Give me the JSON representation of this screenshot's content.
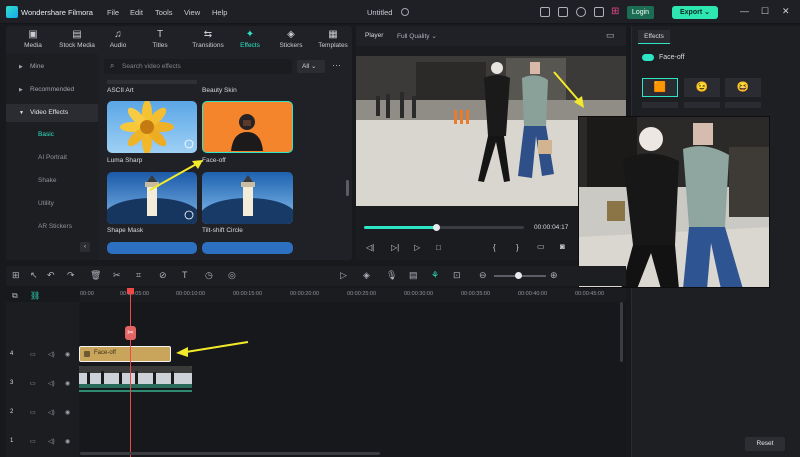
{
  "app": {
    "name": "Wondershare Filmora",
    "menu": [
      "File",
      "Edit",
      "Tools",
      "View",
      "Help"
    ],
    "project_title": "Untitled",
    "login_label": "Login",
    "export_label": "Export"
  },
  "library": {
    "tabs": [
      "Media",
      "Stock Media",
      "Audio",
      "Titles",
      "Transitions",
      "Effects",
      "Stickers",
      "Templates"
    ],
    "active_tab": "Effects",
    "sidebar": [
      "Mine",
      "Recommended",
      "Video Effects",
      "Basic",
      "AI Portrait",
      "Shake",
      "Utility",
      "AR Stickers"
    ],
    "search_placeholder": "Search video effects",
    "filter_label": "All",
    "effects": [
      {
        "name": "ASCII Art"
      },
      {
        "name": "Beauty Skin"
      },
      {
        "name": "Luma Sharp"
      },
      {
        "name": "Face-off"
      },
      {
        "name": "Shape Mask"
      },
      {
        "name": "Tilt-shift Circle"
      }
    ]
  },
  "player": {
    "label": "Player",
    "quality": "Full Quality",
    "timecode": "00:00:04:17",
    "progress": 0.45
  },
  "right_panel": {
    "tab": "Effects",
    "effect_name": "Face-off",
    "reset_label": "Reset"
  },
  "timeline": {
    "ticks": [
      "00:00",
      "00:00:05:00",
      "00:00:10:00",
      "00:00:15:00",
      "00:00:20:00",
      "00:00:25:00",
      "00:00:30:00",
      "00:00:35:00",
      "00:00:40:00",
      "00:00:45:00"
    ],
    "effect_clip": "Face-off",
    "tracks": [
      "4",
      "3",
      "2",
      "1"
    ]
  },
  "colors": {
    "accent": "#2ee6c5",
    "export": "#2ee6b0",
    "clip": "#c9a55c",
    "playhead": "#f04848"
  }
}
